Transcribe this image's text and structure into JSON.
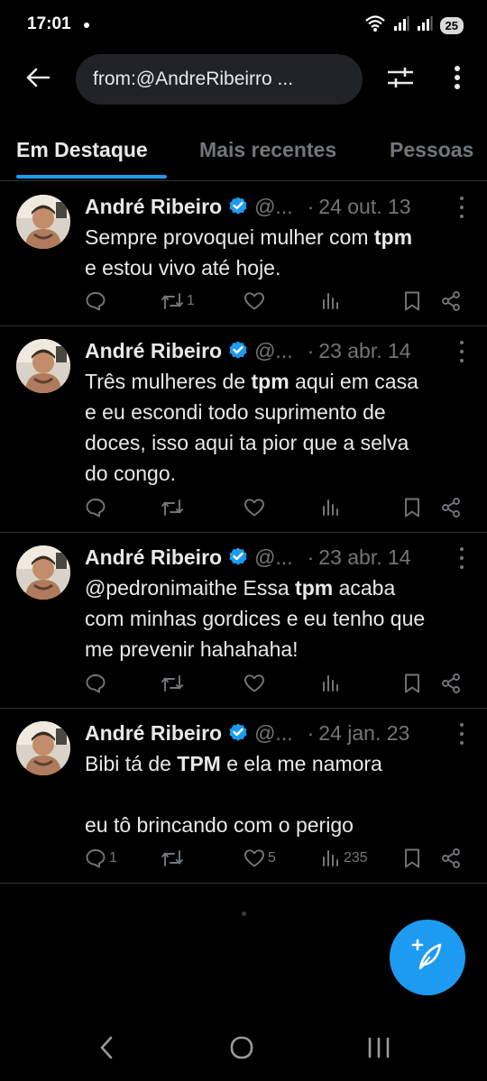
{
  "status_bar": {
    "time": "17:01",
    "battery": "25"
  },
  "search": {
    "query": "from:@AndreRibeirro ..."
  },
  "tabs": [
    {
      "label": "Em Destaque"
    },
    {
      "label": "Mais recentes"
    },
    {
      "label": "Pessoas"
    }
  ],
  "tweets": [
    {
      "author": "André Ribeiro",
      "handle": "@...",
      "date": "24 out. 13",
      "text_lines": [
        [
          {
            "t": "Sempre provoquei mulher com "
          },
          {
            "t": "tpm",
            "b": true
          }
        ],
        [
          {
            "t": "e estou vivo até hoje."
          }
        ]
      ],
      "counts": {
        "replies": "",
        "retweets": "1",
        "likes": "",
        "views": ""
      }
    },
    {
      "author": "André Ribeiro",
      "handle": "@...",
      "date": "23 abr. 14",
      "text_lines": [
        [
          {
            "t": "Três mulheres de "
          },
          {
            "t": "tpm",
            "b": true
          },
          {
            "t": " aqui em casa"
          }
        ],
        [
          {
            "t": "e eu escondi todo suprimento de"
          }
        ],
        [
          {
            "t": "doces, isso aqui ta pior que a selva"
          }
        ],
        [
          {
            "t": "do congo."
          }
        ]
      ],
      "counts": {
        "replies": "",
        "retweets": "",
        "likes": "",
        "views": ""
      }
    },
    {
      "author": "André Ribeiro",
      "handle": "@...",
      "date": "23 abr. 14",
      "text_lines": [
        [
          {
            "t": "@pedronimaithe Essa "
          },
          {
            "t": "tpm",
            "b": true
          },
          {
            "t": " acaba"
          }
        ],
        [
          {
            "t": "com minhas gordices e eu tenho que"
          }
        ],
        [
          {
            "t": "me prevenir hahahaha!"
          }
        ]
      ],
      "counts": {
        "replies": "",
        "retweets": "",
        "likes": "",
        "views": ""
      }
    },
    {
      "author": "André Ribeiro",
      "handle": "@...",
      "date": "24 jan. 23",
      "text_lines": [
        [
          {
            "t": "Bibi tá de "
          },
          {
            "t": "TPM",
            "b": true
          },
          {
            "t": " e ela me namora"
          }
        ],
        [
          {
            "t": ""
          }
        ],
        [
          {
            "t": "eu tô brincando com o perigo"
          }
        ]
      ],
      "counts": {
        "replies": "1",
        "retweets": "",
        "likes": "5",
        "views": "235"
      }
    }
  ],
  "icons": {
    "back": "arrow-left-icon",
    "filter": "sliders-icon",
    "more": "more-vertical-icon",
    "verified": "verified-badge-icon",
    "reply": "reply-icon",
    "retweet": "retweet-icon",
    "like": "heart-icon",
    "views": "views-icon",
    "bookmark": "bookmark-icon",
    "share": "share-icon",
    "compose": "compose-icon"
  },
  "colors": {
    "accent": "#1d9bf0",
    "background": "#000000",
    "muted": "#71767b",
    "text": "#e7e9ea",
    "divider": "#2f3336"
  }
}
